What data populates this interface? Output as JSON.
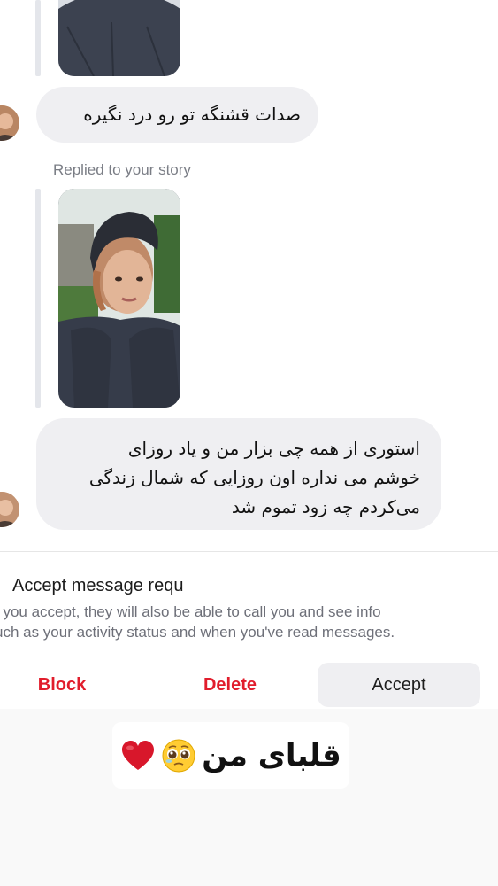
{
  "thread": {
    "message_1": "صدات قشنگه تو رو درد نگیره",
    "replied_label": "Replied to your story",
    "message_2_lines": [
      "استوری از همه چی بزار من و یاد روزای",
      "خوشم می نداره اون روزایی که شمال زندگی",
      "می‌کردم چه زود تموم شد"
    ]
  },
  "request": {
    "title": "Accept message requ",
    "info_lines": [
      "f you accept, they will also be able to call you and see info",
      "uch as your activity status and when you've read messages."
    ],
    "block_label": "Block",
    "delete_label": "Delete",
    "accept_label": "Accept"
  },
  "caption": {
    "text": "قلبای من",
    "emojis": [
      "pleading-face-icon",
      "red-heart-icon"
    ]
  },
  "colors": {
    "bubble": "#efeff2",
    "danger": "#e11d2c",
    "muted_text": "#6e7079"
  }
}
